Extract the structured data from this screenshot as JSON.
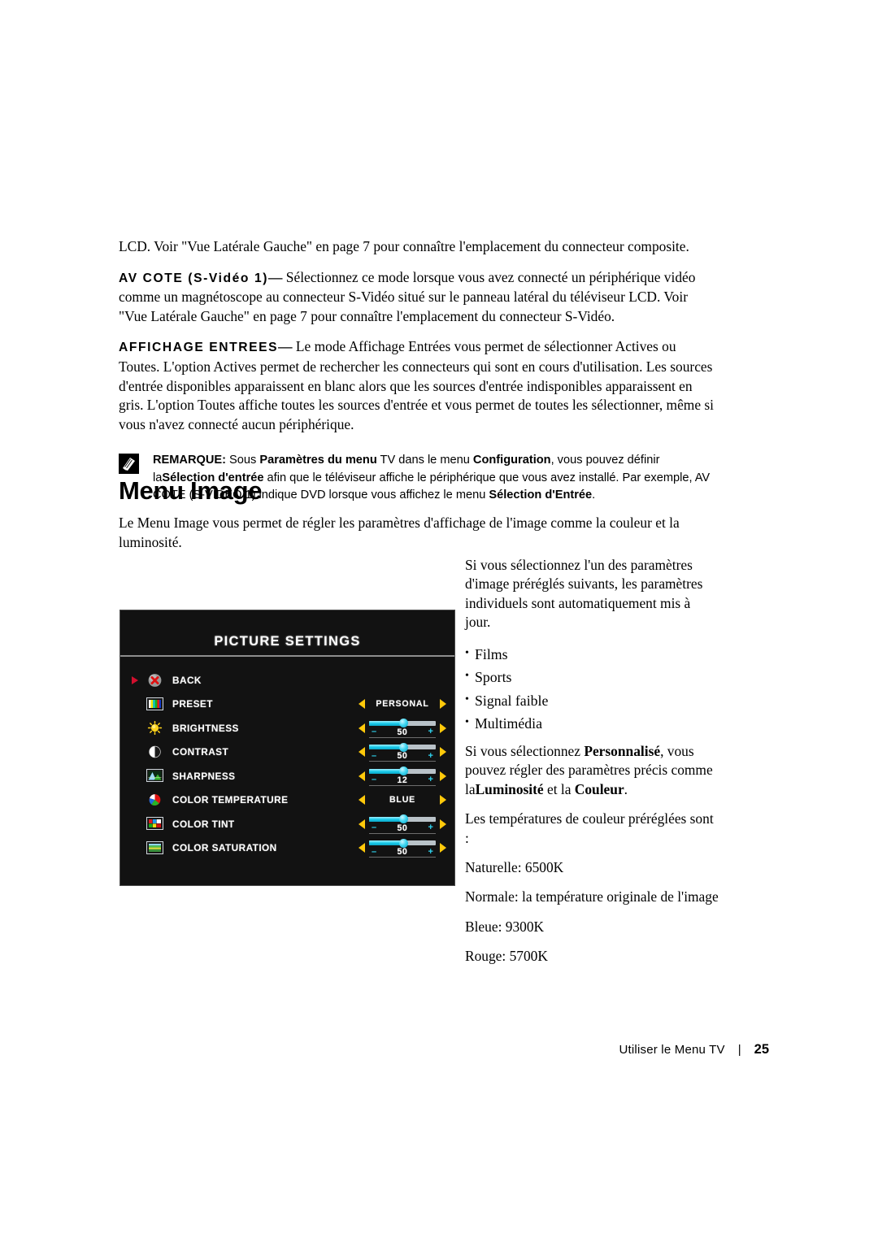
{
  "document": {
    "paragraphs": [
      {
        "id": "p-lcd",
        "text": "LCD. Voir \"Vue Latérale Gauche\" en page 7 pour connaître l'emplacement du connecteur composite."
      },
      {
        "id": "p-av-cote",
        "term": "AV COTE (S-Vidéo 1)",
        "dash": "—",
        "text": "Sélectionnez ce mode lorsque vous avez connecté un périphérique vidéo comme un magnétoscope au connecteur S-Vidéo situé sur le panneau latéral du téléviseur LCD. Voir \"Vue Latérale Gauche\" en page 7 pour connaître l'emplacement du connecteur S-Vidéo."
      },
      {
        "id": "p-affichage",
        "term": "AFFICHAGE ENTREES",
        "dash": "—",
        "text": "Le mode Affichage Entrées vous permet de sélectionner Actives ou Toutes. L'option Actives permet de rechercher les connecteurs qui sont en cours d'utilisation. Les sources d'entrée disponibles apparaissent en blanc alors que les sources d'entrée indisponibles apparaissent en gris. L'option Toutes affiche toutes les sources d'entrée et vous permet de toutes les sélectionner, même si vous n'avez connecté aucun périphérique."
      }
    ],
    "note": {
      "icon": "note-pencil-icon",
      "label": "REMARQUE:",
      "segments": [
        {
          "text": " Sous ",
          "bold": false
        },
        {
          "text": "Paramètres du menu",
          "bold": true
        },
        {
          "text": " TV dans le menu ",
          "bold": false
        },
        {
          "text": "Configuration",
          "bold": true
        },
        {
          "text": ", vous pouvez définir la",
          "bold": false
        },
        {
          "text": "Sélection d'entrée",
          "bold": true
        },
        {
          "text": " afin que le téléviseur affiche le périphérique que vous avez installé. Par exemple, AV COTE (S-VIDEO 1) indique DVD lorsque vous affichez le menu ",
          "bold": false
        },
        {
          "text": "Sélection d'Entrée",
          "bold": true
        },
        {
          "text": ".",
          "bold": false
        }
      ]
    },
    "heading": "Menu Image",
    "intro": "Le Menu Image vous permet de régler les paramètres d'affichage de l'image comme la couleur et la luminosité."
  },
  "right_column": {
    "intro": "Si vous sélectionnez l'un des paramètres d'image préréglés suivants, les paramètres individuels sont automatiquement mis à jour.",
    "presets": [
      "Films",
      "Sports",
      "Signal faible",
      "Multimédia"
    ],
    "personal_note": {
      "lead": "Si vous sélectionnez ",
      "bold1": "Personnalisé",
      "mid": ", vous pouvez régler des paramètres précis comme la",
      "bold2": "Luminosité",
      "mid2": " et la ",
      "bold3": "Couleur",
      "tail": "."
    },
    "temps_intro": "Les températures de couleur préréglées sont :",
    "temperatures": [
      "Naturelle: 6500K",
      "Normale: la température originale de l'image",
      "Bleue: 9300K",
      "Rouge: 5700K"
    ]
  },
  "osd": {
    "title": "PICTURE SETTINGS",
    "colors": {
      "panel_bg": "#121212",
      "border": "#4a4a4a",
      "arrow_yellow": "#ffc90a",
      "cursor_red": "#d10f2e",
      "slider_cyan": "#15c8e8",
      "slider_track": "#b9c2c8",
      "text_white": "#ffffff"
    },
    "rows": [
      {
        "name": "back",
        "label": "BACK",
        "icon": "back-x-sphere-icon",
        "selected": true,
        "control": "none"
      },
      {
        "name": "preset",
        "label": "PRESET",
        "icon": "preset-colorbars-icon",
        "selected": false,
        "control": "option",
        "value": "PERSONAL"
      },
      {
        "name": "brightness",
        "label": "BRIGHTNESS",
        "icon": "brightness-sun-icon",
        "selected": false,
        "control": "slider",
        "value": "50",
        "fill_percent": 52
      },
      {
        "name": "contrast",
        "label": "CONTRAST",
        "icon": "contrast-halfcircle-icon",
        "selected": false,
        "control": "slider",
        "value": "50",
        "fill_percent": 52
      },
      {
        "name": "sharpness",
        "label": "SHARPNESS",
        "icon": "sharpness-mountain-icon",
        "selected": false,
        "control": "slider",
        "value": "12",
        "fill_percent": 52
      },
      {
        "name": "color-temperature",
        "label": "COLOR TEMPERATURE",
        "icon": "color-temperature-piechart-icon",
        "selected": false,
        "control": "option",
        "value": "BLUE"
      },
      {
        "name": "color-tint",
        "label": "COLOR TINT",
        "icon": "color-tint-screen-icon",
        "selected": false,
        "control": "slider",
        "value": "50",
        "fill_percent": 52
      },
      {
        "name": "color-saturation",
        "label": "COLOR SATURATION",
        "icon": "color-saturation-screen-icon",
        "selected": false,
        "control": "slider",
        "value": "50",
        "fill_percent": 52
      }
    ],
    "slider_minus": "–",
    "slider_plus": "+"
  },
  "footer": {
    "label": "Utiliser le Menu TV",
    "separator": "|",
    "page": "25"
  }
}
